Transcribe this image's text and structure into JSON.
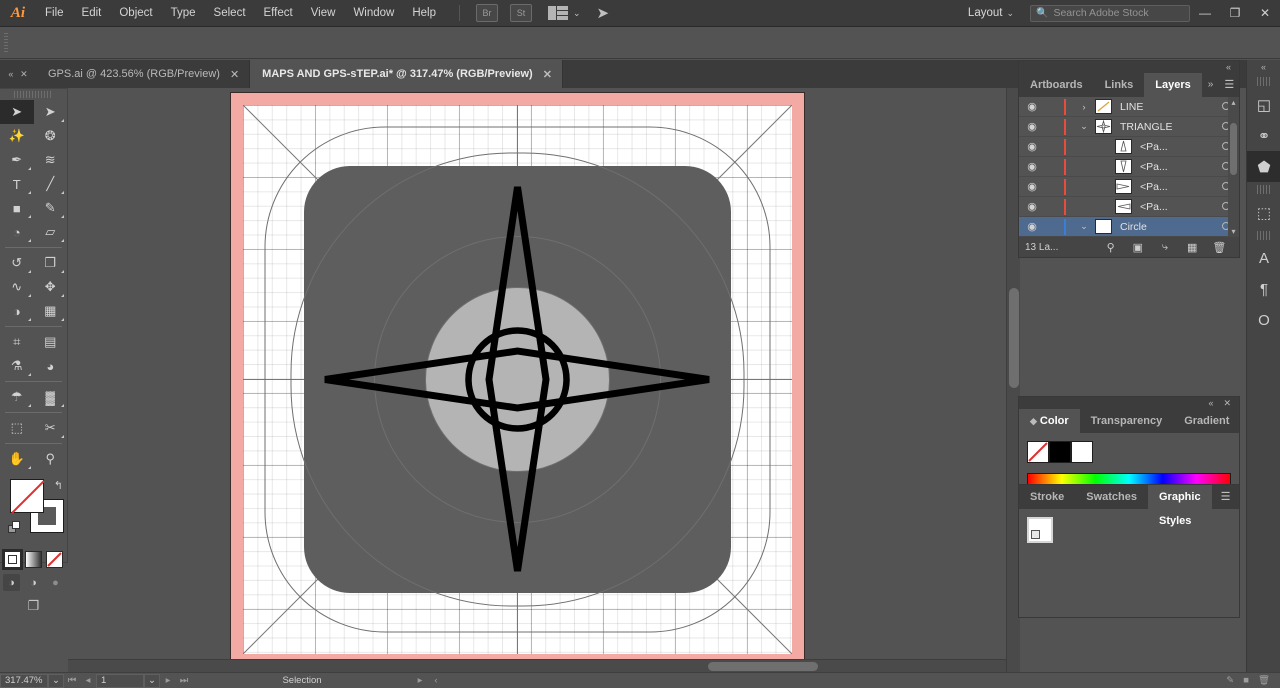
{
  "app": {
    "name": "Adobe Illustrator",
    "logo": "Ai"
  },
  "menubar": {
    "items": [
      "File",
      "Edit",
      "Object",
      "Type",
      "Select",
      "Effect",
      "View",
      "Window",
      "Help"
    ],
    "bridge_label": "Br",
    "stock_label": "St",
    "arrange_icon": "panel-grid-icon",
    "arrange_caret": "⌄",
    "swoosh_icon": "swoosh-icon",
    "layout_label": "Layout",
    "layout_caret": "⌄",
    "search": {
      "placeholder": "Search Adobe Stock",
      "value": "",
      "icon": "search-icon"
    },
    "window_controls": {
      "minimize": "—",
      "restore": "❐",
      "close": "✕"
    }
  },
  "tabbar": {
    "collapse_left": "«",
    "collapse_close": "✕",
    "tabs": [
      {
        "title": "GPS.ai @ 423.56% (RGB/Preview)",
        "close": "✕",
        "active": false
      },
      {
        "title": "MAPS AND GPS-sTEP.ai* @ 317.47% (RGB/Preview)",
        "close": "✕",
        "active": true
      }
    ],
    "right_collapse": "«"
  },
  "toolbar": {
    "rows": [
      [
        {
          "name": "selection-tool",
          "glyph": "➤",
          "selected": true,
          "corner": false
        },
        {
          "name": "direct-selection-tool",
          "glyph": "➤",
          "selected": false,
          "corner": true
        }
      ],
      [
        {
          "name": "magic-wand-tool",
          "glyph": "✨",
          "selected": false,
          "corner": false
        },
        {
          "name": "lasso-tool",
          "glyph": "❂",
          "selected": false,
          "corner": false
        }
      ],
      [
        {
          "name": "pen-tool",
          "glyph": "✒",
          "selected": false,
          "corner": true
        },
        {
          "name": "curvature-tool",
          "glyph": "≋",
          "selected": false,
          "corner": false
        }
      ],
      [
        {
          "name": "type-tool",
          "glyph": "T",
          "selected": false,
          "corner": true
        },
        {
          "name": "line-segment-tool",
          "glyph": "╱",
          "selected": false,
          "corner": true
        }
      ],
      [
        {
          "name": "rectangle-tool",
          "glyph": "■",
          "selected": false,
          "corner": true
        },
        {
          "name": "paintbrush-tool",
          "glyph": "✎",
          "selected": false,
          "corner": true
        }
      ],
      [
        {
          "name": "shaper-tool",
          "glyph": "◔",
          "selected": false,
          "corner": true
        },
        {
          "name": "eraser-tool",
          "glyph": "▱",
          "selected": false,
          "corner": true
        }
      ],
      [
        {
          "name": "rotate-tool",
          "glyph": "↺",
          "selected": false,
          "corner": true
        },
        {
          "name": "scale-tool",
          "glyph": "❐",
          "selected": false,
          "corner": true
        }
      ],
      [
        {
          "name": "width-tool",
          "glyph": "∿",
          "selected": false,
          "corner": true
        },
        {
          "name": "free-transform-tool",
          "glyph": "✥",
          "selected": false,
          "corner": true
        }
      ],
      [
        {
          "name": "shape-builder-tool",
          "glyph": "◑",
          "selected": false,
          "corner": true
        },
        {
          "name": "perspective-grid-tool",
          "glyph": "▦",
          "selected": false,
          "corner": true
        }
      ],
      [
        {
          "name": "mesh-tool",
          "glyph": "⌗",
          "selected": false,
          "corner": false
        },
        {
          "name": "gradient-tool",
          "glyph": "▤",
          "selected": false,
          "corner": false
        }
      ],
      [
        {
          "name": "eyedropper-tool",
          "glyph": "⚗",
          "selected": false,
          "corner": true
        },
        {
          "name": "blend-tool",
          "glyph": "◕",
          "selected": false,
          "corner": false
        }
      ],
      [
        {
          "name": "symbol-sprayer-tool",
          "glyph": "☂",
          "selected": false,
          "corner": true
        },
        {
          "name": "column-graph-tool",
          "glyph": "▓",
          "selected": false,
          "corner": true
        }
      ],
      [
        {
          "name": "artboard-tool",
          "glyph": "⬚",
          "selected": false,
          "corner": false
        },
        {
          "name": "slice-tool",
          "glyph": "✂",
          "selected": false,
          "corner": true
        }
      ],
      [
        {
          "name": "hand-tool",
          "glyph": "✋",
          "selected": false,
          "corner": true
        },
        {
          "name": "zoom-tool",
          "glyph": "⚲",
          "selected": false,
          "corner": false
        }
      ]
    ],
    "fill_label": "fill-swatch",
    "stroke_label": "stroke-swatch",
    "swap_glyph": "↰",
    "modes": [
      "color-mode",
      "gradient-mode",
      "none-mode"
    ],
    "draw_modes": [
      "draw-normal",
      "draw-behind",
      "draw-inside"
    ],
    "screen_mode_glyph": "❐"
  },
  "panels": {
    "layers": {
      "tabs": [
        {
          "label": "Artboards",
          "active": false
        },
        {
          "label": "Links",
          "active": false
        },
        {
          "label": "Layers",
          "active": true
        }
      ],
      "expand_glyph": "»",
      "burger_glyph": "☰",
      "collapse_glyph": "«",
      "close_glyph": "✕",
      "rows": [
        {
          "name": "LINE",
          "indent": 0,
          "arrow": "›",
          "selected": false,
          "color": "#e84c3d",
          "eye": "◉",
          "target": "○",
          "thumb": "line-thumb"
        },
        {
          "name": "TRIANGLE",
          "indent": 0,
          "arrow": "⌄",
          "selected": false,
          "color": "#e84c3d",
          "eye": "◉",
          "target": "○",
          "thumb": "triangle-thumb"
        },
        {
          "name": "<Pa...",
          "indent": 1,
          "arrow": "",
          "selected": false,
          "color": "#e84c3d",
          "eye": "◉",
          "target": "○",
          "thumb": "path-thumb-up"
        },
        {
          "name": "<Pa...",
          "indent": 1,
          "arrow": "",
          "selected": false,
          "color": "#e84c3d",
          "eye": "◉",
          "target": "○",
          "thumb": "path-thumb-down"
        },
        {
          "name": "<Pa...",
          "indent": 1,
          "arrow": "",
          "selected": false,
          "color": "#e84c3d",
          "eye": "◉",
          "target": "○",
          "thumb": "path-thumb-right"
        },
        {
          "name": "<Pa...",
          "indent": 1,
          "arrow": "",
          "selected": false,
          "color": "#e84c3d",
          "eye": "◉",
          "target": "○",
          "thumb": "path-thumb-left"
        },
        {
          "name": "Circle",
          "indent": 0,
          "arrow": "⌄",
          "selected": true,
          "color": "#3a7fd5",
          "eye": "◉",
          "target": "○",
          "thumb": "circle-thumb"
        }
      ],
      "footer": {
        "count": "13 La...",
        "icons": [
          "locate-object-icon",
          "make-mask-icon",
          "new-sublayer-icon",
          "new-layer-icon",
          "delete-layer-icon"
        ],
        "glyphs": [
          "⚲",
          "◱",
          "⤷",
          "◧",
          "Ὕ1"
        ]
      },
      "scroll_up": "▴",
      "scroll_down": "▾"
    },
    "color": {
      "collapse_glyph": "«",
      "close_glyph": "✕",
      "tabs": [
        {
          "label": "Color",
          "active": true
        },
        {
          "label": "Transparency",
          "active": false
        },
        {
          "label": "Gradient",
          "active": false
        }
      ],
      "burger_glyph": "☰",
      "swatches": [
        {
          "name": "none-swatch",
          "color": "#ffffff",
          "slash": true
        },
        {
          "name": "black-swatch",
          "color": "#000000",
          "slash": false
        },
        {
          "name": "white-swatch",
          "color": "#ffffff",
          "slash": false
        }
      ],
      "spectrum_label": "color-spectrum-ramp"
    },
    "graphic_styles": {
      "tabs": [
        {
          "label": "Stroke",
          "active": false
        },
        {
          "label": "Swatches",
          "active": false
        },
        {
          "label": "Graphic Styles",
          "active": true
        }
      ],
      "burger_glyph": "☰",
      "styles": [
        {
          "name": "default-graphic-style"
        }
      ]
    },
    "icon_rail": [
      {
        "name": "rail-artboards-icon",
        "glyph": "◱",
        "selected": false
      },
      {
        "name": "rail-links-icon",
        "glyph": "⚭",
        "selected": false
      },
      {
        "name": "rail-layers-icon",
        "glyph": "⬟",
        "selected": true
      },
      {
        "name": "rail-transform-icon",
        "glyph": "⬚",
        "selected": false
      },
      {
        "name": "rail-character-icon",
        "glyph": "A",
        "selected": false
      },
      {
        "name": "rail-paragraph-icon",
        "glyph": "¶",
        "selected": false
      },
      {
        "name": "rail-glyphs-icon",
        "glyph": "O",
        "selected": false
      }
    ]
  },
  "statusbar": {
    "zoom": "317.47%",
    "zoom_caret": "⌄",
    "nav_first": "⏮",
    "nav_prev": "◂",
    "page": "1",
    "page_caret": "⌄",
    "nav_next": "▸",
    "nav_last": "⏭",
    "status_text": "Selection",
    "status_arrow": "▸",
    "resize_glyph": "‹"
  },
  "artwork": {
    "title": "gps-compass-star-icon",
    "bleed_color": "#f3aaa4",
    "artboard_color": "#ffffff",
    "rounded_square_color": "#5e5e5e",
    "inner_circle_color": "#b4b4b4",
    "stroke_color": "#000000",
    "guide_color": "#6f6f6f",
    "grid_color": "rgba(0,0,0,0.09)"
  }
}
